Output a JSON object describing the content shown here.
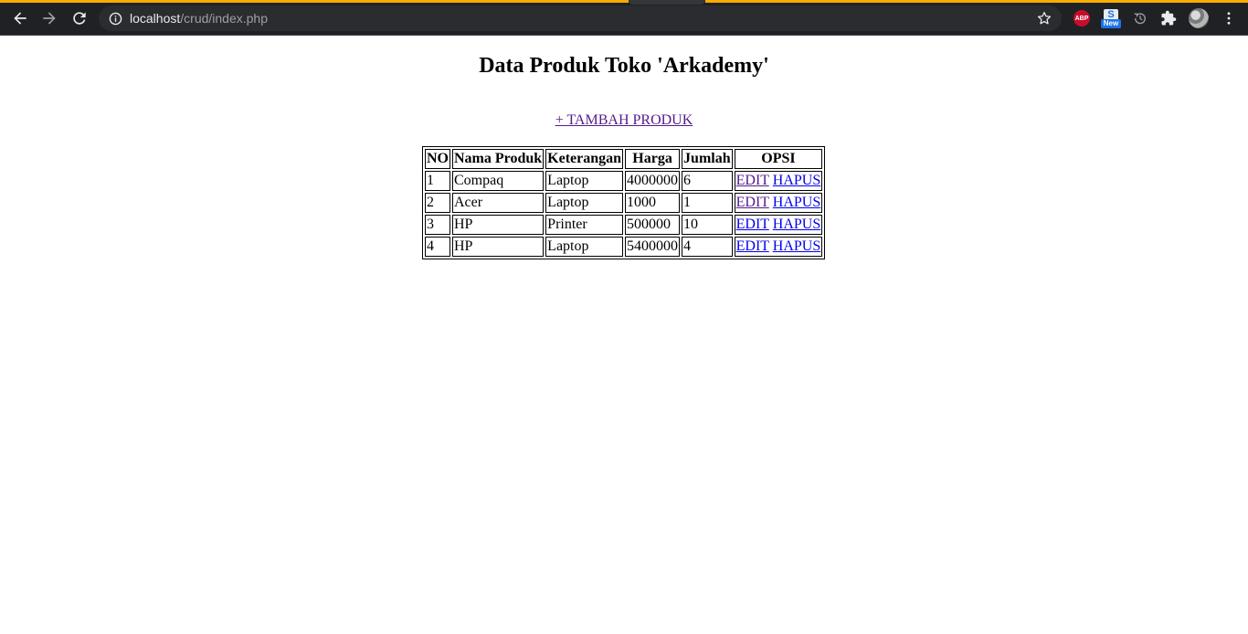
{
  "browser": {
    "accent_color": "#f9ab00",
    "url_host": "localhost",
    "url_path": "/crud/index.php",
    "icons": {
      "back": "arrow-left-icon",
      "forward": "arrow-right-icon",
      "reload": "reload-icon",
      "site_info": "info-icon",
      "bookmark": "star-icon",
      "extensions": "puzzle-icon",
      "menu": "kebab-menu-icon"
    },
    "extensions": {
      "abp_label": "ABP",
      "s_label": "S",
      "new_badge": "New"
    }
  },
  "page": {
    "title": "Data Produk Toko 'Arkademy'",
    "add_link": "+ TAMBAH PRODUK",
    "table": {
      "headers": [
        "NO",
        "Nama Produk",
        "Keterangan",
        "Harga",
        "Jumlah",
        "OPSI"
      ],
      "rows": [
        {
          "no": "1",
          "nama": "Compaq",
          "keterangan": "Laptop",
          "harga": "4000000",
          "jumlah": "6",
          "edit": "EDIT",
          "hapus": "HAPUS"
        },
        {
          "no": "2",
          "nama": "Acer",
          "keterangan": "Laptop",
          "harga": "1000",
          "jumlah": "1",
          "edit": "EDIT",
          "hapus": "HAPUS"
        },
        {
          "no": "3",
          "nama": "HP",
          "keterangan": "Printer",
          "harga": "500000",
          "jumlah": "10",
          "edit": "EDIT",
          "hapus": "HAPUS"
        },
        {
          "no": "4",
          "nama": "HP",
          "keterangan": "Laptop",
          "harga": "5400000",
          "jumlah": "4",
          "edit": "EDIT",
          "hapus": "HAPUS"
        }
      ]
    },
    "colors": {
      "link_visited": "#551a8b",
      "link_unvisited": "#0000ee"
    }
  }
}
